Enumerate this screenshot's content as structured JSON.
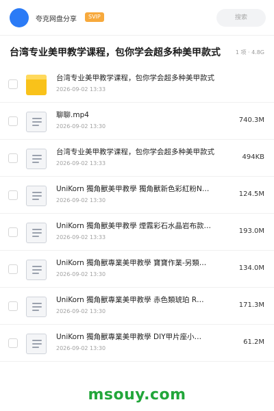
{
  "header": {
    "app_name": "夸克网盘分享",
    "badge": "SVIP",
    "search_label": "搜索"
  },
  "folder": {
    "title": "台湾专业美甲教学课程，包你学会超多种美甲款式",
    "meta": "1 项 · 4.8G"
  },
  "files": [
    {
      "name": "台湾专业美甲教学课程，包你学会超多种美甲款式",
      "date": "2026-09-02 13:33",
      "size": "",
      "icon": "folder-icon"
    },
    {
      "name": "聊聊.mp4",
      "date": "2026-09-02 13:30",
      "size": "740.3M",
      "icon": "file-icon"
    },
    {
      "name": "台湾专业美甲教学课程，包你学会超多种美甲款式",
      "date": "2026-09-02 13:33",
      "size": "494KB",
      "icon": "file-icon"
    },
    {
      "name": "UniKorn 獨角獸美甲教學 獨角獸新色彩紅粉N…",
      "date": "2026-09-02 13:30",
      "size": "124.5M",
      "icon": "file-icon"
    },
    {
      "name": "UniKorn 獨角獸美甲教學 煙霧彩石水晶岩布款…",
      "date": "2026-09-02 13:33",
      "size": "193.0M",
      "icon": "file-icon"
    },
    {
      "name": "UniKorn 獨角獸專業美甲教學 寶寶作業-另類…",
      "date": "2026-09-02 13:30",
      "size": "134.0M",
      "icon": "file-icon"
    },
    {
      "name": "UniKorn 獨角獸專業美甲教學 赤色類琥珀 R…",
      "date": "2026-09-02 13:30",
      "size": "171.3M",
      "icon": "file-icon"
    },
    {
      "name": "UniKorn 獨角獸專業美甲教學 DIY甲片座小…",
      "date": "2026-09-02 13:30",
      "size": "61.2M",
      "icon": "file-icon"
    }
  ],
  "watermark": "msouy.com",
  "colors": {
    "accent": "#2b7bf6",
    "badge": "#f7a93c",
    "folder": "#f9c21a",
    "watermark": "#22a63a"
  }
}
